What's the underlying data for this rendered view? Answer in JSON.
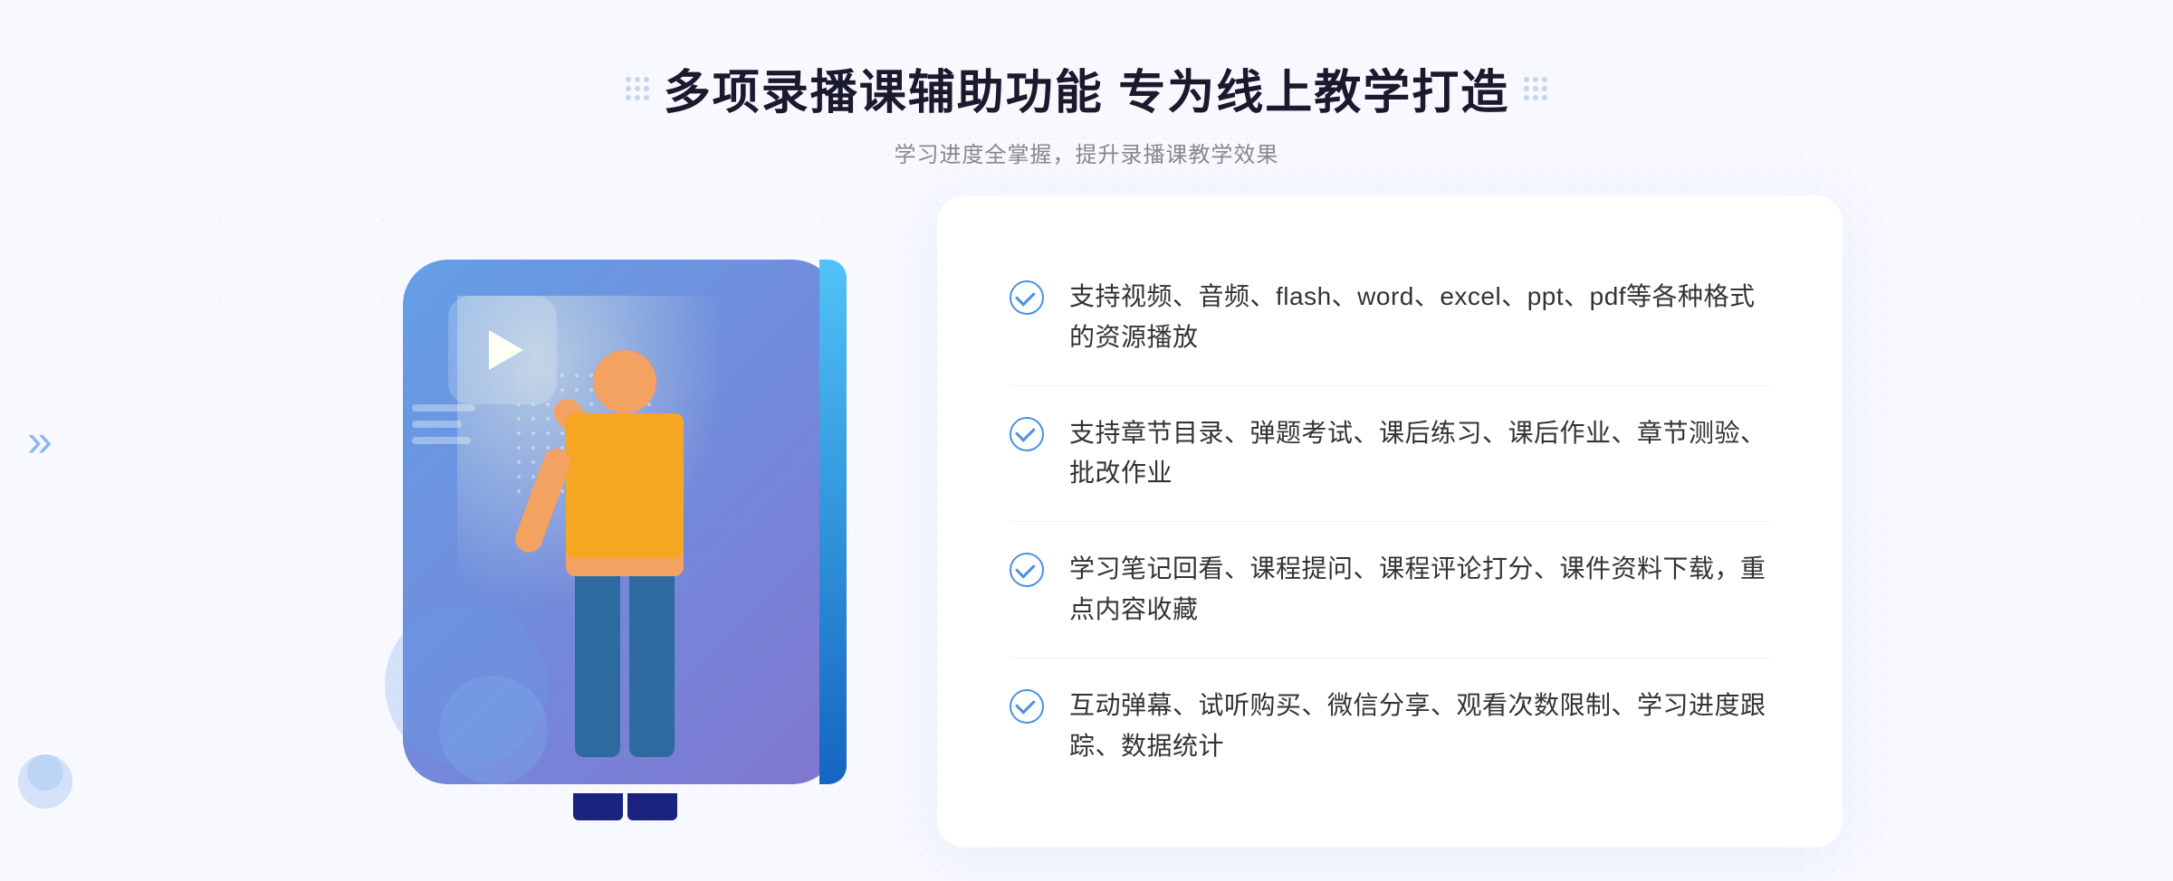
{
  "header": {
    "title": "多项录播课辅助功能 专为线上教学打造",
    "subtitle": "学习进度全掌握，提升录播课教学效果"
  },
  "features": [
    {
      "id": 1,
      "text": "支持视频、音频、flash、word、excel、ppt、pdf等各种格式的资源播放"
    },
    {
      "id": 2,
      "text": "支持章节目录、弹题考试、课后练习、课后作业、章节测验、批改作业"
    },
    {
      "id": 3,
      "text": "学习笔记回看、课程提问、课程评论打分、课件资料下载，重点内容收藏"
    },
    {
      "id": 4,
      "text": "互动弹幕、试听购买、微信分享、观看次数限制、学习进度跟踪、数据统计"
    }
  ],
  "decorations": {
    "chevron": "»"
  }
}
